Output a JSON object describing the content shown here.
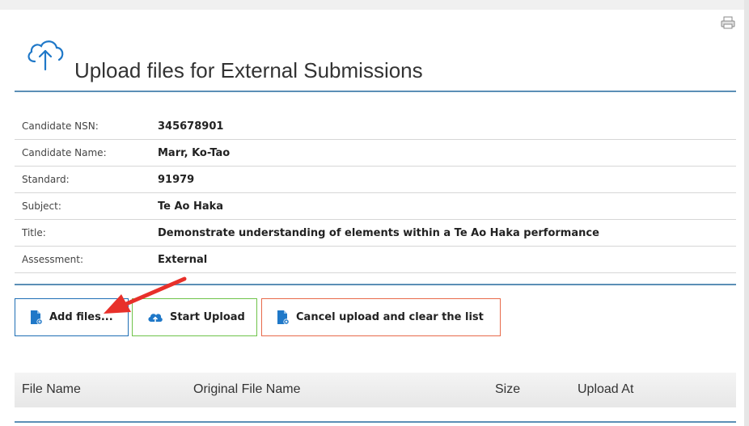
{
  "page": {
    "title": "Upload files for External Submissions"
  },
  "details": [
    {
      "label": "Candidate NSN:",
      "value": "345678901"
    },
    {
      "label": "Candidate Name:",
      "value": "Marr, Ko-Tao"
    },
    {
      "label": "Standard:",
      "value": "91979"
    },
    {
      "label": "Subject:",
      "value": "Te Ao Haka"
    },
    {
      "label": "Title:",
      "value": "Demonstrate understanding of elements within a Te Ao Haka performance"
    },
    {
      "label": "Assessment:",
      "value": "External"
    }
  ],
  "buttons": {
    "add": "Add files...",
    "start": "Start Upload",
    "cancel": "Cancel upload and clear the list"
  },
  "file_table": {
    "columns": [
      "File Name",
      "Original File Name",
      "Size",
      "Upload At"
    ]
  },
  "icons": {
    "print": "print-icon",
    "cloud_upload": "cloud-upload-icon",
    "add_file": "file-add-icon",
    "start_upload": "cloud-upload-icon",
    "cancel_upload": "file-cancel-icon",
    "annotation_arrow": "arrow-icon"
  },
  "colors": {
    "accent": "#5b8fb6",
    "icon_blue": "#1f78c8",
    "add_border": "#1f6fb5",
    "start_border": "#6fc34a",
    "cancel_border": "#e86a4a",
    "arrow": "#e8302a"
  }
}
